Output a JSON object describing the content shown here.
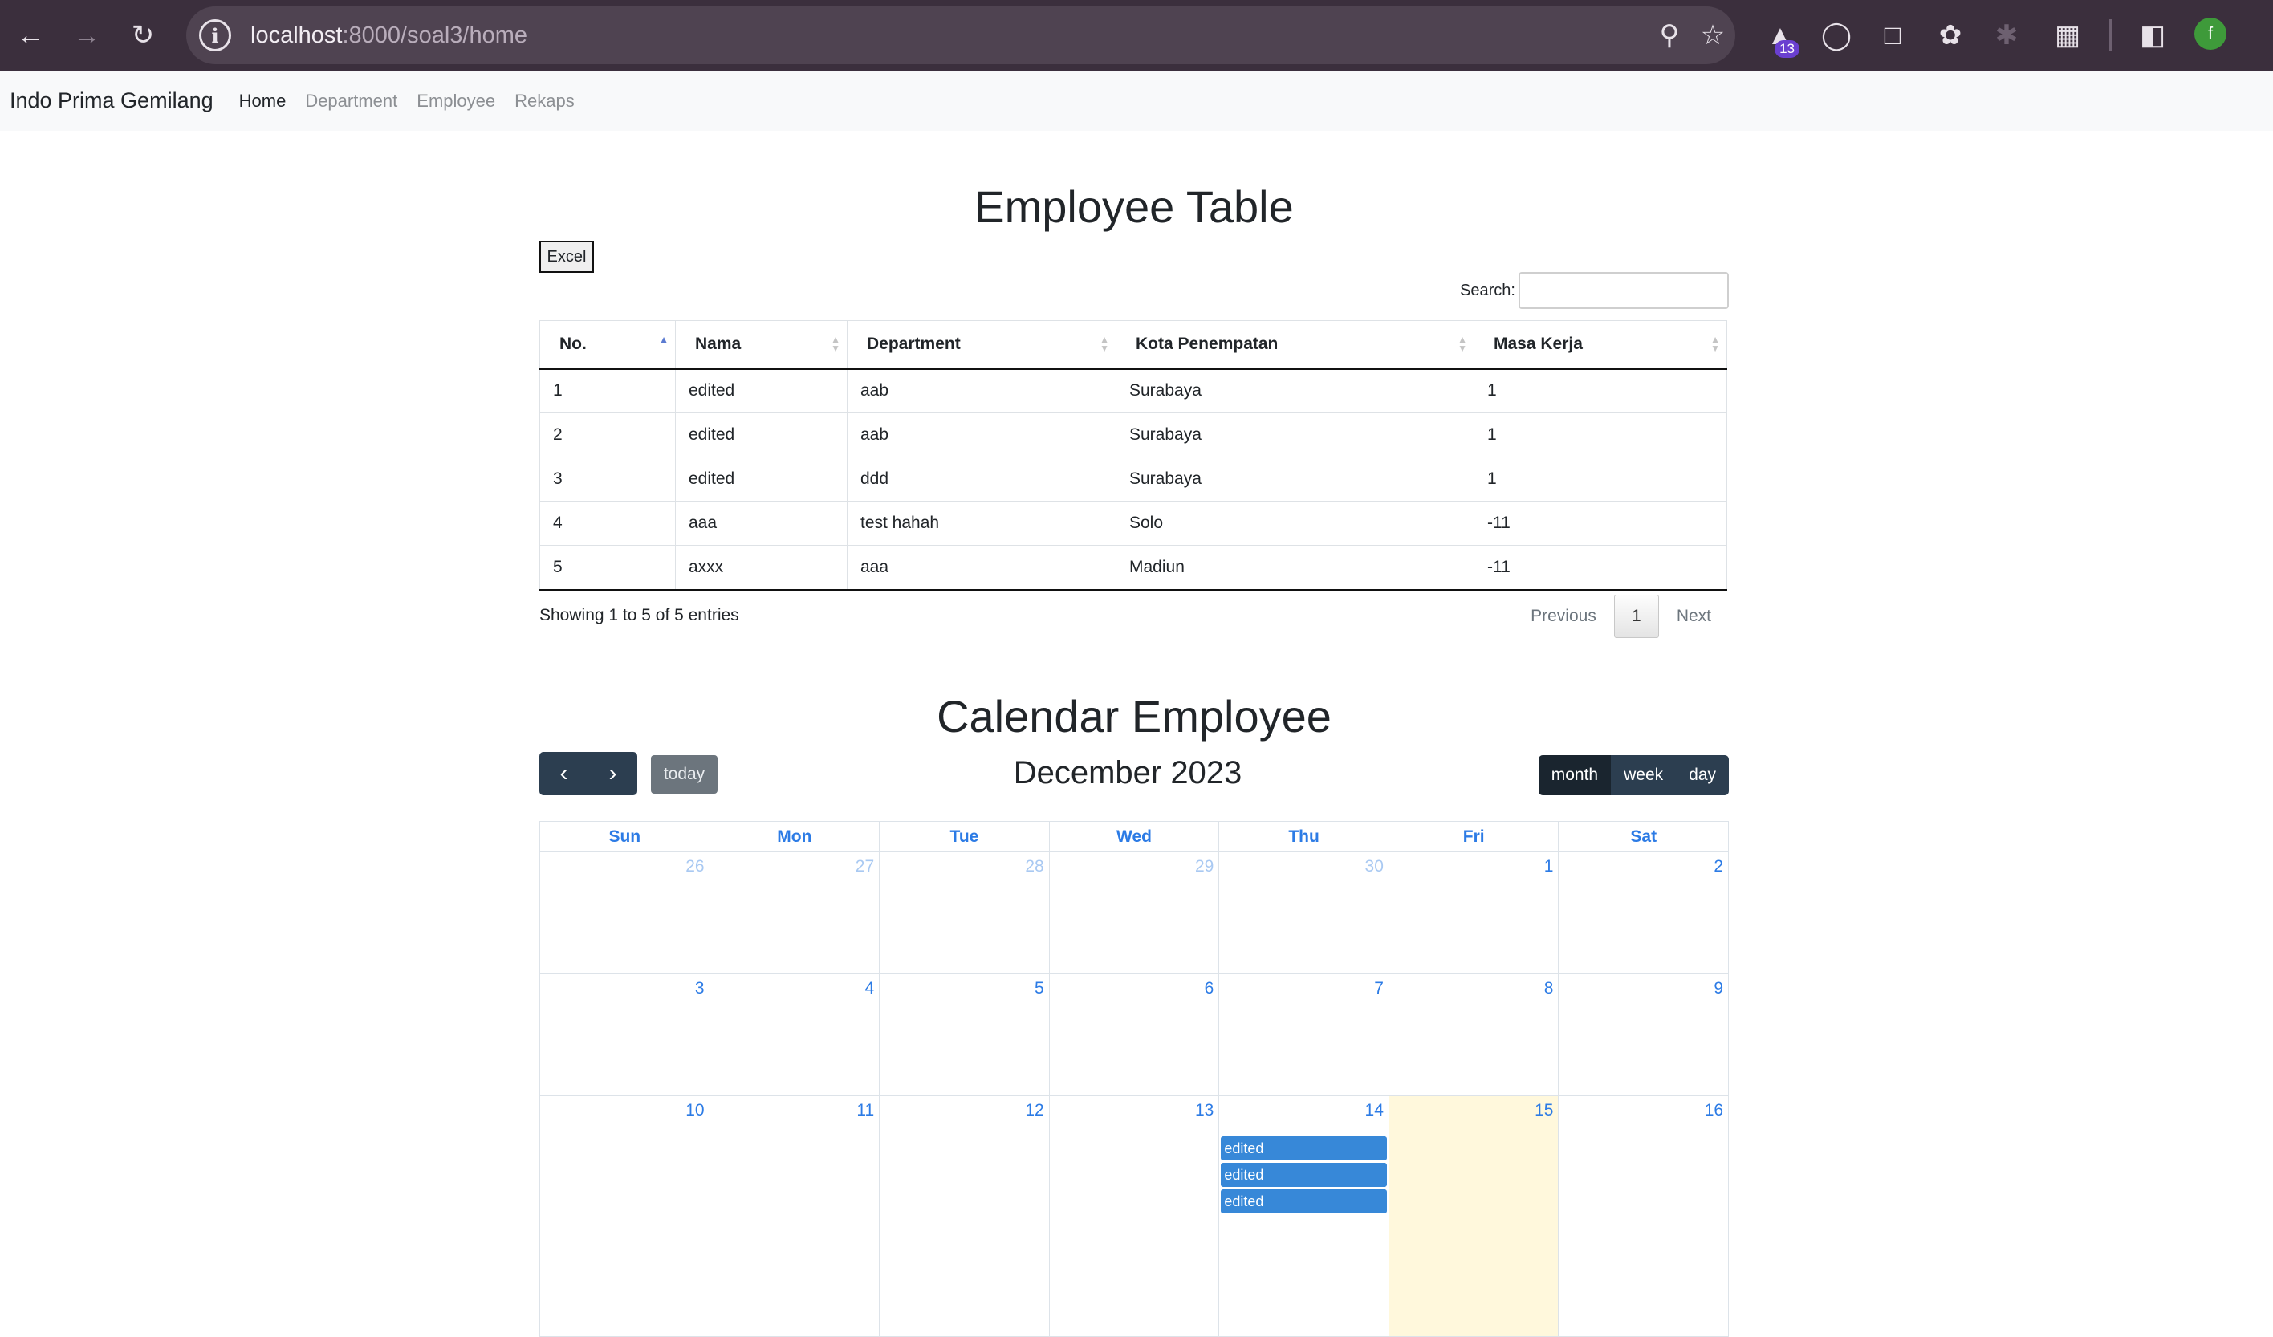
{
  "browser": {
    "url_host": "localhost",
    "url_rest": ":8000/soal3/home",
    "ext_badge": "13",
    "profile_initial": "f"
  },
  "nav": {
    "brand": "Indo Prima Gemilang",
    "links": [
      "Home",
      "Department",
      "Employee",
      "Rekaps"
    ]
  },
  "employee": {
    "title": "Employee Table",
    "excel_label": "Excel",
    "search_label": "Search:",
    "search_value": "",
    "columns": [
      "No.",
      "Nama",
      "Department",
      "Kota Penempatan",
      "Masa Kerja"
    ],
    "rows": [
      [
        "1",
        "edited",
        "aab",
        "Surabaya",
        "1"
      ],
      [
        "2",
        "edited",
        "aab",
        "Surabaya",
        "1"
      ],
      [
        "3",
        "edited",
        "ddd",
        "Surabaya",
        "1"
      ],
      [
        "4",
        "aaa",
        "test hahah",
        "Solo",
        "-11"
      ],
      [
        "5",
        "axxx",
        "aaa",
        "Madiun",
        "-11"
      ]
    ],
    "info": "Showing 1 to 5 of 5 entries",
    "prev": "Previous",
    "page": "1",
    "next": "Next"
  },
  "calendar": {
    "title": "Calendar Employee",
    "month_label": "December 2023",
    "today_label": "today",
    "views": [
      "month",
      "week",
      "day"
    ],
    "active_view": "month",
    "weekdays": [
      "Sun",
      "Mon",
      "Tue",
      "Wed",
      "Thu",
      "Fri",
      "Sat"
    ],
    "weeks": [
      [
        {
          "d": "26",
          "other": true
        },
        {
          "d": "27",
          "other": true
        },
        {
          "d": "28",
          "other": true
        },
        {
          "d": "29",
          "other": true
        },
        {
          "d": "30",
          "other": true
        },
        {
          "d": "1"
        },
        {
          "d": "2"
        }
      ],
      [
        {
          "d": "3"
        },
        {
          "d": "4"
        },
        {
          "d": "5"
        },
        {
          "d": "6"
        },
        {
          "d": "7"
        },
        {
          "d": "8"
        },
        {
          "d": "9"
        }
      ],
      [
        {
          "d": "10"
        },
        {
          "d": "11"
        },
        {
          "d": "12"
        },
        {
          "d": "13"
        },
        {
          "d": "14",
          "events": [
            "edited",
            "edited",
            "edited"
          ]
        },
        {
          "d": "15",
          "today": true
        },
        {
          "d": "16"
        }
      ]
    ],
    "colors": {
      "accent": "#2c7be5",
      "event": "#3788d8",
      "button": "#2c3e50",
      "today_bg": "#fff8dc"
    }
  }
}
